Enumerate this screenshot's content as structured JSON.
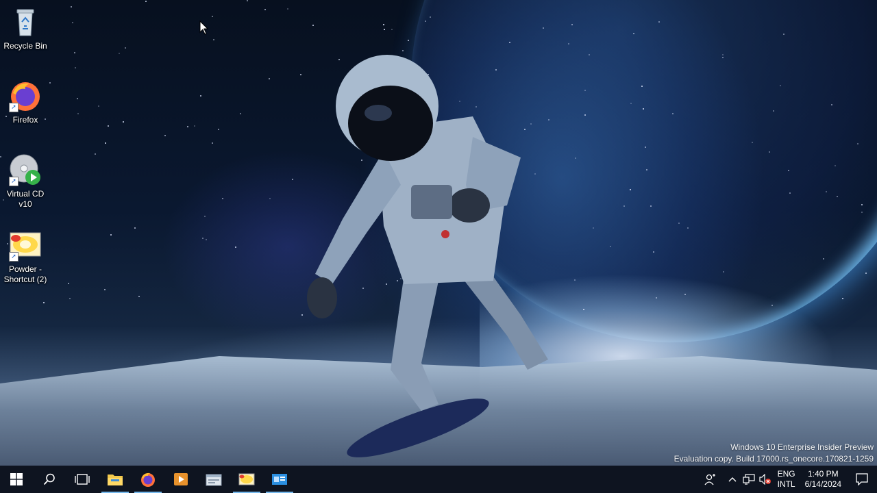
{
  "desktop": {
    "icons": [
      {
        "label": "Recycle Bin",
        "icon": "recycle-bin-icon"
      },
      {
        "label": "Firefox",
        "icon": "firefox-icon"
      },
      {
        "label": "Virtual CD v10",
        "icon": "virtual-cd-icon"
      },
      {
        "label": "Powder - Shortcut (2)",
        "icon": "powder-icon"
      }
    ],
    "watermark": {
      "line1": "Windows 10 Enterprise Insider Preview",
      "line2": "Evaluation copy. Build 17000.rs_onecore.170821-1259"
    }
  },
  "taskbar": {
    "buttons": [
      {
        "name": "start-button",
        "icon": "windows-logo-icon"
      },
      {
        "name": "search-button",
        "icon": "search-icon"
      },
      {
        "name": "task-view-button",
        "icon": "task-view-icon"
      },
      {
        "name": "file-explorer-button",
        "icon": "folder-icon",
        "active": true
      },
      {
        "name": "firefox-taskbar-button",
        "icon": "firefox-icon",
        "active": true
      },
      {
        "name": "media-player-button",
        "icon": "media-player-icon"
      },
      {
        "name": "app-button-window",
        "icon": "window-app-icon"
      },
      {
        "name": "powder-taskbar-button",
        "icon": "powder-icon",
        "active": true
      },
      {
        "name": "app-button-blue",
        "icon": "blue-app-icon",
        "active": true
      }
    ],
    "tray": {
      "language_top": "ENG",
      "language_bottom": "INTL",
      "time": "1:40 PM",
      "date": "6/14/2024"
    }
  },
  "colors": {
    "taskbar_bg": "#0e1420",
    "active_indicator": "#76b9ed"
  }
}
